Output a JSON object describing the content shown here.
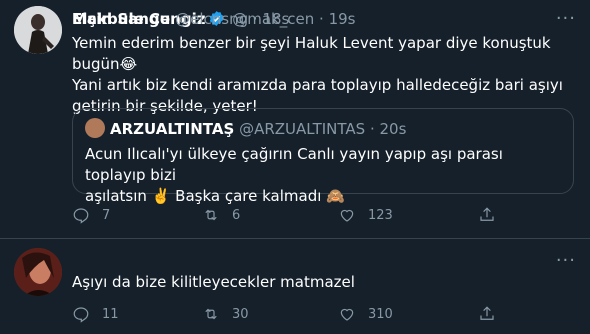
{
  "tweet1": {
    "name": "Makbule Cengiz",
    "handle": "@mak_cen",
    "time": "19s",
    "text_line1": "Yemin ederim benzer bir şeyi Haluk Levent yapar diye konuştuk bugün",
    "emoji1": "😂",
    "text_line2": "Yani artık biz kendi aramızda para toplayıp halledeceğiz bari aşıyı getirin bir şekilde, yeter!",
    "quote": {
      "name": "ARZUALTINTAŞ",
      "handle": "@ARZUALTINTAS",
      "time": "20s",
      "text_line1": "Acun Ilıcalı'yı ülkeye çağırın Canlı yayın yapıp aşı parası toplayıp bizi",
      "text_line2_a": "aşılatsın",
      "emoji_a": "✌️",
      "text_line2_b": "Başka çare kalmadı",
      "emoji_b": "🙈"
    },
    "replies": "7",
    "retweets": "6",
    "likes": "123"
  },
  "tweet2": {
    "name": "Elçin Sangu",
    "handle": "@elcnsng",
    "time": "18s",
    "text": "Aşıyı da bize kilitleyecekler matmazel",
    "replies": "11",
    "retweets": "30",
    "likes": "310"
  },
  "dot": "·",
  "more_glyph": "···",
  "colors": {
    "background": "#15202b",
    "secondary_text": "#8899a6",
    "border": "#38444d",
    "verified": "#1da1f2"
  }
}
